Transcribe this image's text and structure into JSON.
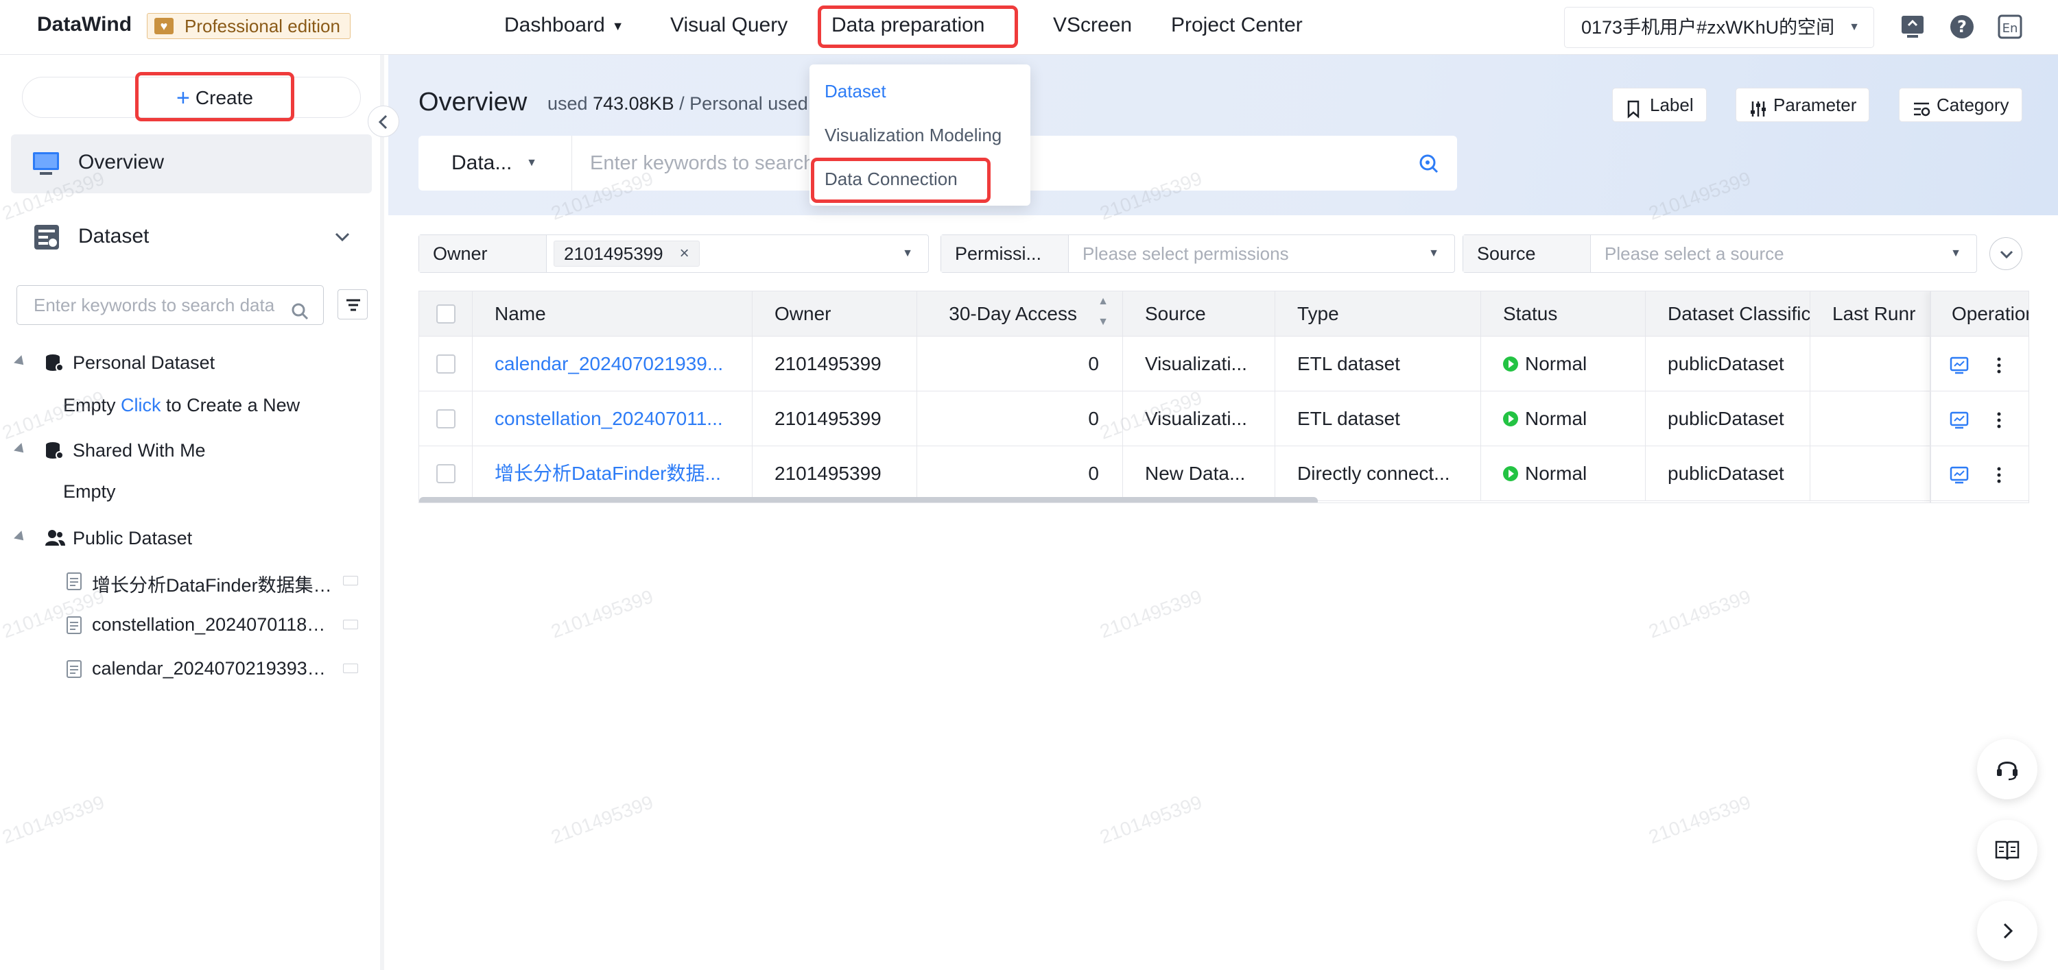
{
  "app": {
    "brand": "DataWind",
    "edition": "Professional edition"
  },
  "nav": {
    "items": [
      {
        "label": "Dashboard"
      },
      {
        "label": "Visual Query"
      },
      {
        "label": "Data preparation"
      },
      {
        "label": "VScreen"
      },
      {
        "label": "Project Center"
      }
    ],
    "space": "0173手机用户#zxWKhU的空间"
  },
  "dropdown": {
    "items": [
      "Dataset",
      "Visualization Modeling",
      "Data Connection"
    ]
  },
  "sidebar": {
    "create_label": "Create",
    "overview_label": "Overview",
    "dataset_label": "Dataset",
    "search_placeholder": "Enter keywords to search data",
    "tree": {
      "personal": "Personal Dataset",
      "personal_empty": "Empty",
      "personal_click": "Click",
      "personal_create": " to Create a New",
      "shared": "Shared With Me",
      "shared_empty": "Empty",
      "public": "Public Dataset",
      "public_items": [
        "增长分析DataFinder数据集_...",
        "constellation_20240701185...",
        "calendar_20240702193930..."
      ]
    }
  },
  "main": {
    "title": "Overview",
    "used_prefix": "used ",
    "used_value": "743.08KB",
    "used_suffix": " / Personal used",
    "buttons": {
      "label": "Label",
      "parameter": "Parameter",
      "category": "Category"
    },
    "search_type": "Data...",
    "search_placeholder": "Enter keywords to search",
    "filters": {
      "owner_label": "Owner",
      "owner_chip": "2101495399",
      "permission_label": "Permissi...",
      "permission_placeholder": "Please select permissions",
      "source_label": "Source",
      "source_placeholder": "Please select a source"
    }
  },
  "table": {
    "columns": [
      "Name",
      "Owner",
      "30-Day Access",
      "Source",
      "Type",
      "Status",
      "Dataset Classific",
      "Last Runr",
      "Operation"
    ],
    "rows": [
      {
        "name": "calendar_202407021939...",
        "owner": "2101495399",
        "access": "0",
        "source": "Visualizati...",
        "type": "ETL dataset",
        "status": "Normal",
        "classification": "publicDataset"
      },
      {
        "name": "constellation_202407011...",
        "owner": "2101495399",
        "access": "0",
        "source": "Visualizati...",
        "type": "ETL dataset",
        "status": "Normal",
        "classification": "publicDataset"
      },
      {
        "name": "增长分析DataFinder数据...",
        "owner": "2101495399",
        "access": "0",
        "source": "New Data...",
        "type": "Directly connect...",
        "status": "Normal",
        "classification": "publicDataset"
      }
    ]
  },
  "watermark": "2101495399",
  "colors": {
    "accent": "#2d7cf6",
    "highlight": "#ef3b3b",
    "status_ok": "#23c343",
    "edition_bg": "#fdf3e3"
  }
}
